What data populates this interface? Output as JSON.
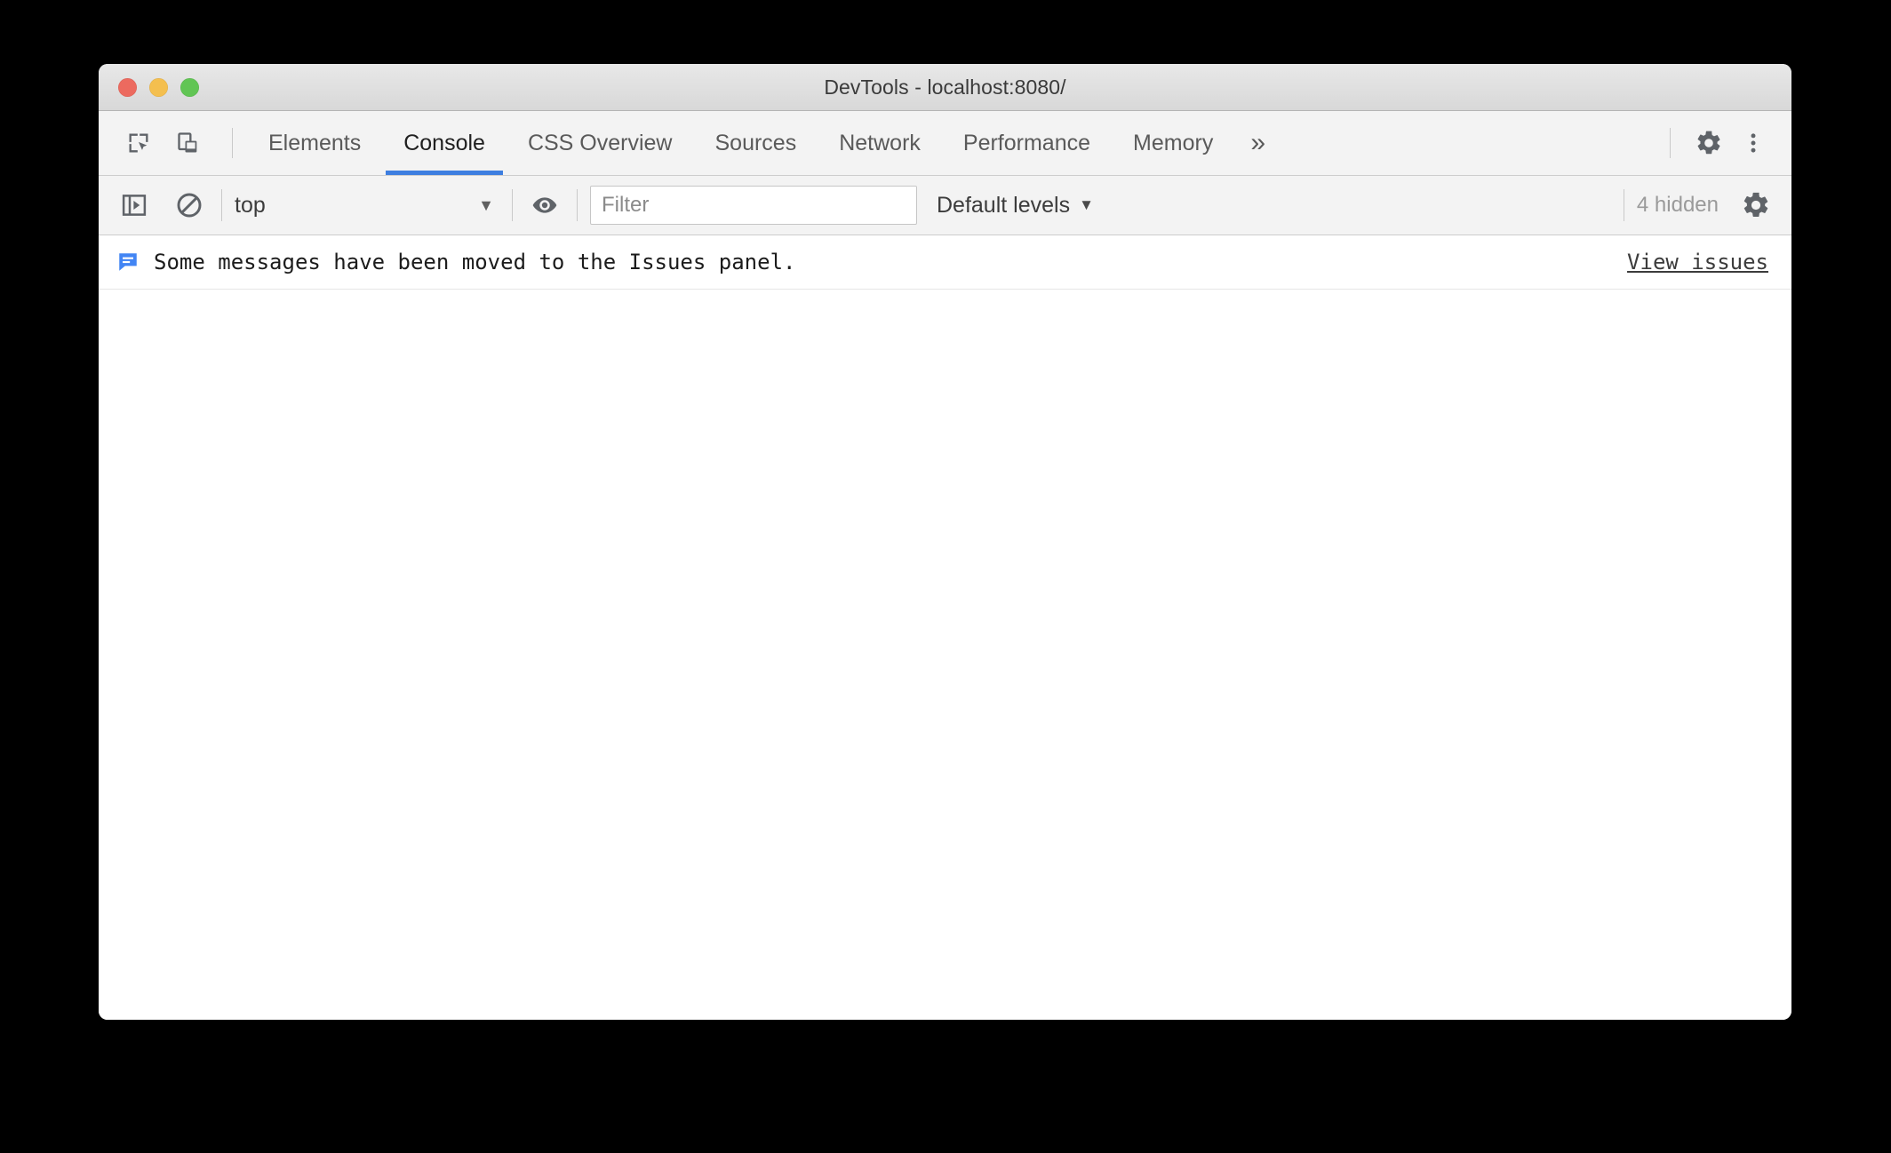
{
  "window": {
    "title": "DevTools - localhost:8080/",
    "traffic_lights": [
      {
        "name": "close",
        "color": "#ec6a5f"
      },
      {
        "name": "minimize",
        "color": "#f4bf4f"
      },
      {
        "name": "maximize",
        "color": "#61c554"
      }
    ]
  },
  "colors": {
    "accent": "#3d7ee0",
    "info_icon": "#4285f4",
    "toolbar_bg": "#f3f3f3",
    "titlebar_bg": "#e0e0e0",
    "body_bg": "#ffffff",
    "border": "#cdcdcd"
  },
  "tabbar": {
    "left_icons": [
      {
        "name": "inspect-element-icon",
        "title": "Inspect element"
      },
      {
        "name": "device-toolbar-icon",
        "title": "Toggle device toolbar"
      }
    ],
    "tabs": [
      {
        "label": "Elements",
        "active": false
      },
      {
        "label": "Console",
        "active": true
      },
      {
        "label": "CSS Overview",
        "active": false
      },
      {
        "label": "Sources",
        "active": false
      },
      {
        "label": "Network",
        "active": false
      },
      {
        "label": "Performance",
        "active": false
      },
      {
        "label": "Memory",
        "active": false
      }
    ],
    "more_tabs_label": "»",
    "right_icons": [
      {
        "name": "gear-icon",
        "title": "Settings"
      },
      {
        "name": "more-vertical-icon",
        "title": "Customize and control DevTools"
      }
    ]
  },
  "console_toolbar": {
    "sidebar_toggle": {
      "name": "show-console-sidebar-icon"
    },
    "clear_console": {
      "name": "clear-console-icon"
    },
    "context": {
      "value": "top",
      "caret": "▼"
    },
    "live_expression": {
      "name": "eye-icon"
    },
    "filter": {
      "placeholder": "Filter",
      "value": ""
    },
    "levels": {
      "label": "Default levels",
      "caret": "▼"
    },
    "hidden_count": "4 hidden",
    "settings": {
      "name": "gear-icon"
    }
  },
  "console": {
    "messages": [
      {
        "icon": "info-message-icon",
        "text": "Some messages have been moved to the Issues panel.",
        "link": "View issues"
      }
    ]
  }
}
